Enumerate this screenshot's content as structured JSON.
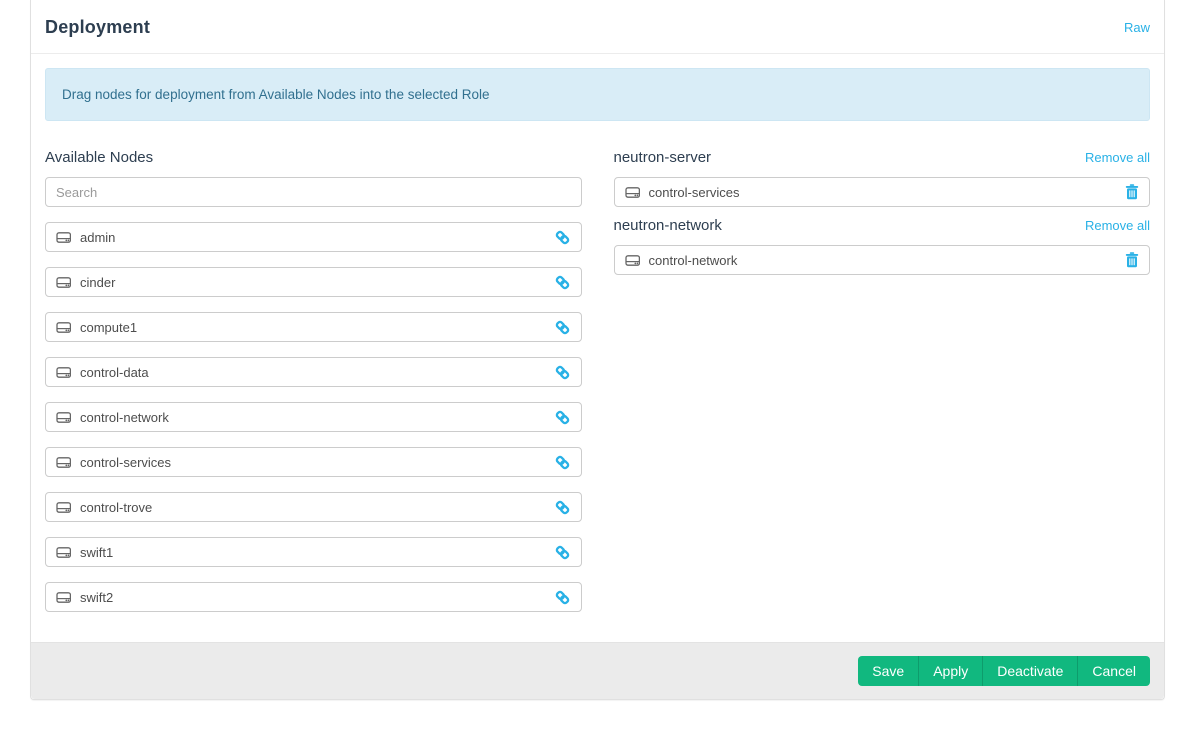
{
  "page": {
    "title": "Deployment",
    "raw_link_label": "Raw"
  },
  "banner": {
    "text": "Drag nodes for deployment from Available Nodes into the selected Role"
  },
  "available": {
    "heading": "Available Nodes",
    "search_placeholder": "Search",
    "nodes": [
      "admin",
      "cinder",
      "compute1",
      "control-data",
      "control-network",
      "control-services",
      "control-trove",
      "swift1",
      "swift2"
    ]
  },
  "roles": [
    {
      "name": "neutron-server",
      "remove_all_label": "Remove all",
      "nodes": [
        "control-services"
      ]
    },
    {
      "name": "neutron-network",
      "remove_all_label": "Remove all",
      "nodes": [
        "control-network"
      ]
    }
  ],
  "footer": {
    "buttons": [
      "Save",
      "Apply",
      "Deactivate",
      "Cancel"
    ]
  },
  "icons": {
    "node": "hdd-icon",
    "assign": "link-icon",
    "remove": "trash-icon"
  },
  "colors": {
    "accent": "#29b1e6",
    "success": "#11b87f",
    "heading_text": "#2d3e50",
    "banner_bg": "#d9edf7",
    "banner_text": "#31708f"
  }
}
